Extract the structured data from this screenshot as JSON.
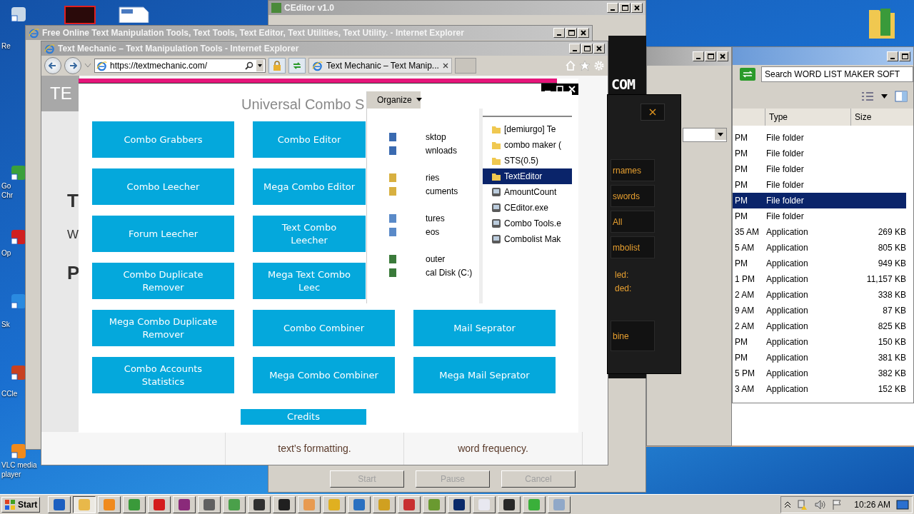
{
  "desktop": {
    "icons": [
      {
        "label": "Re"
      },
      {
        "label": "Go\nChr"
      },
      {
        "label": "Op"
      },
      {
        "label": "Sk"
      },
      {
        "label": "CCle"
      },
      {
        "label": "VLC media\nplayer"
      }
    ]
  },
  "ceditor": {
    "title": "CEditor v1.0",
    "buttons": [
      {
        "label": "Start",
        "disabled": true
      },
      {
        "label": "Pause",
        "disabled": true
      },
      {
        "label": "Cancel",
        "disabled": true
      }
    ]
  },
  "ie_back": {
    "title": "Free Online Text Manipulation Tools, Text Tools, Text Editor, Text Utilities, Text Utility. - Internet Explorer"
  },
  "ie_front": {
    "title": "Text Mechanic – Text Manipulation Tools - Internet Explorer",
    "address": "https://textmechanic.com/",
    "tab": "Text Mechanic – Text Manip...",
    "page": {
      "fragments": [
        "TE",
        "T",
        "W",
        "P"
      ],
      "bottom_texts": [
        "text’s formatting.",
        "word frequency."
      ]
    }
  },
  "combo_tool": {
    "title": "Universal Combo S",
    "rows": [
      [
        "Combo Grabbers",
        "Combo Editor"
      ],
      [
        "Combo Leecher",
        "Mega Combo Editor"
      ],
      [
        "Forum Leecher",
        "Text Combo Leecher"
      ],
      [
        "Combo Duplicate Remover",
        "Mega Text Combo Leec"
      ],
      [
        "Mega Combo Duplicate Remover",
        "Combo Combiner",
        "Mail Seprator"
      ],
      [
        "Combo Accounts Statistics",
        "Mega Combo Combiner",
        "Mega Mail Seprator"
      ]
    ],
    "credits": "Credits"
  },
  "folder_pane": {
    "organize": "Organize",
    "nav_groups": [
      [
        "sktop",
        "wnloads"
      ],
      [
        "ries",
        "cuments"
      ],
      [
        "tures",
        "eos"
      ],
      [
        "outer",
        "cal Disk (C:)"
      ]
    ],
    "files": [
      {
        "name": "[demiurgo] Te",
        "kind": "folder",
        "selected": false
      },
      {
        "name": "combo maker (",
        "kind": "folder",
        "selected": false
      },
      {
        "name": "STS(0.5)",
        "kind": "folder",
        "selected": false
      },
      {
        "name": "TextEditor",
        "kind": "folder",
        "selected": true
      },
      {
        "name": "AmountCount",
        "kind": "app",
        "selected": false
      },
      {
        "name": "CEditor.exe",
        "kind": "app",
        "selected": false
      },
      {
        "name": "Combo Tools.e",
        "kind": "app",
        "selected": false
      },
      {
        "name": "Combolist Mak",
        "kind": "app",
        "selected": false
      }
    ]
  },
  "dark_tool": {
    "brand": "COM",
    "buttons": [
      "rnames",
      "swords",
      "All",
      "mbolist"
    ],
    "labels": [
      "led:",
      "ded:"
    ],
    "action": "bine"
  },
  "explorer": {
    "search": "Search WORD LIST MAKER SOFT",
    "columns": [
      "Type",
      "Size"
    ],
    "rows": [
      {
        "date": "PM",
        "type": "File folder",
        "selected": false
      },
      {
        "date": "PM",
        "type": "File folder",
        "selected": false
      },
      {
        "date": "PM",
        "type": "File folder",
        "selected": false
      },
      {
        "date": "PM",
        "type": "File folder",
        "selected": false
      },
      {
        "date": "PM",
        "type": "File folder",
        "selected": true
      },
      {
        "date": "PM",
        "type": "File folder",
        "selected": false
      },
      {
        "date": "35 AM",
        "type": "Application",
        "size": "269 KB",
        "selected": false
      },
      {
        "date": "5 AM",
        "type": "Application",
        "size": "805 KB",
        "selected": false
      },
      {
        "date": "PM",
        "type": "Application",
        "size": "949 KB",
        "selected": false
      },
      {
        "date": "1 PM",
        "type": "Application",
        "size": "11,157 KB",
        "selected": false
      },
      {
        "date": "2 AM",
        "type": "Application",
        "size": "338 KB",
        "selected": false
      },
      {
        "date": "9 AM",
        "type": "Application",
        "size": "87 KB",
        "selected": false
      },
      {
        "date": "2 AM",
        "type": "Application",
        "size": "825 KB",
        "selected": false
      },
      {
        "date": "PM",
        "type": "Application",
        "size": "150 KB",
        "selected": false
      },
      {
        "date": "PM",
        "type": "Application",
        "size": "381 KB",
        "selected": false
      },
      {
        "date": "5 PM",
        "type": "Application",
        "size": "382 KB",
        "selected": false
      },
      {
        "date": "3 AM",
        "type": "Application",
        "size": "152 KB",
        "selected": false
      }
    ]
  },
  "taskbar": {
    "start": "Start",
    "apps": [
      {
        "color": "#1c5fc0",
        "selected": false
      },
      {
        "color": "#e8b84a",
        "selected": true
      },
      {
        "color": "#f08a1c",
        "selected": false
      },
      {
        "color": "#3a9a3a",
        "selected": false
      },
      {
        "color": "#d41c1c",
        "selected": false
      },
      {
        "color": "#8a2a7a",
        "selected": false
      },
      {
        "color": "#606060",
        "selected": false
      },
      {
        "color": "#4aa04a",
        "selected": false
      },
      {
        "color": "#303030",
        "selected": false
      },
      {
        "color": "#202020",
        "selected": false
      },
      {
        "color": "#e89a50",
        "selected": false
      },
      {
        "color": "#e0b020",
        "selected": false
      },
      {
        "color": "#2a70c0",
        "selected": false
      },
      {
        "color": "#d0a020",
        "selected": false
      },
      {
        "color": "#c83030",
        "selected": false
      },
      {
        "color": "#6a9a30",
        "selected": false
      },
      {
        "color": "#0a2a6a",
        "selected": false
      },
      {
        "color": "#e8e8f0",
        "selected": false
      },
      {
        "color": "#282828",
        "selected": false
      },
      {
        "color": "#3ab03a",
        "selected": false
      },
      {
        "color": "#90a8c8",
        "selected": false
      }
    ],
    "clock": "10:26 AM"
  }
}
